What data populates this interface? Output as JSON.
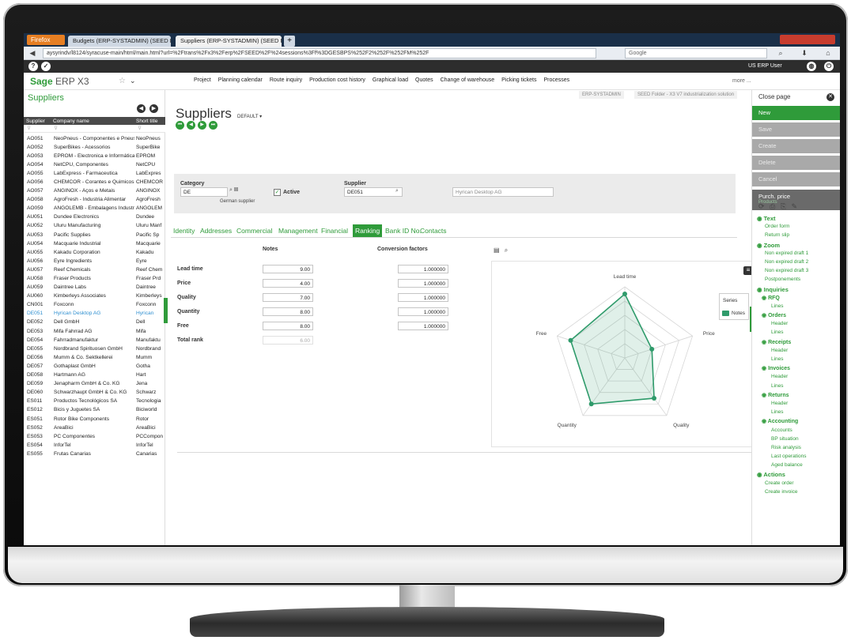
{
  "browser": {
    "firefox_label": "Firefox",
    "tabs": [
      {
        "label": "Budgets (ERP-SYSTADMIN) (SEED Fol..."
      },
      {
        "label": "Suppliers (ERP-SYSTADMIN) (SEED Fo..."
      }
    ],
    "new_tab": "+",
    "url": "aysyrindv/l8124/syracuse-main/html/main.html?url=%2Ftrans%2Fx3%2Ferp%2FSEED%2F%24sessions%3Ff%3DGESBPS%252F2%252F%252FM%252F",
    "search_placeholder": "Google"
  },
  "app": {
    "logo": "Sage",
    "logo_product": "ERP X3",
    "user_label": "US ERP User",
    "menu": [
      {
        "label": "Project",
        "dim": false
      },
      {
        "label": "Planning calendar",
        "dim": false
      },
      {
        "label": "Route inquiry",
        "dim": false
      },
      {
        "label": "Production cost history",
        "dim": false
      },
      {
        "label": "Graphical load",
        "dim": false
      },
      {
        "label": "Quotes",
        "dim": false
      },
      {
        "label": "Change of warehouse",
        "dim": false
      },
      {
        "label": "Picking tickets",
        "dim": false
      },
      {
        "label": "Processes",
        "dim": false
      }
    ],
    "more_label": "more ..."
  },
  "left": {
    "title": "Suppliers",
    "col_supplier": "Supplier",
    "col_company": "Company name",
    "col_short": "Short title",
    "filter_glyph": "⊽",
    "rows": [
      [
        "AO051",
        "NeoPneus - Componentes e Pneus",
        "NeoPneus"
      ],
      [
        "AO052",
        "SuperBikes - Acessorios",
        "SuperBike"
      ],
      [
        "AO053",
        "EPROM - Electronica e Informática",
        "EPROM"
      ],
      [
        "AO054",
        "NetCPU, Componentes",
        "NetCPU"
      ],
      [
        "AO055",
        "LabExpress - Farmaceutica",
        "LabExpres"
      ],
      [
        "AO056",
        "CHEMCOR - Corantes e Quimicos",
        "CHEMCOR"
      ],
      [
        "AO057",
        "ANGINOX - Aços e Metais",
        "ANGINOX"
      ],
      [
        "AO058",
        "AgroFresh - Industria Alimentar",
        "AgroFresh"
      ],
      [
        "AO059",
        "ANGOLEMB - Embalagens Industriais",
        "ANGOLEM"
      ],
      [
        "AU051",
        "Dundee Electronics",
        "Dundee"
      ],
      [
        "AU052",
        "Uluru Manufacturing",
        "Uluru Manf"
      ],
      [
        "AU053",
        "Pacific Supplies",
        "Pacific Sp"
      ],
      [
        "AU054",
        "Macquarie Industrial",
        "Macquarie"
      ],
      [
        "AU055",
        "Kakadu Corporation",
        "Kakadu"
      ],
      [
        "AU056",
        "Eyre Ingredients",
        "Eyre"
      ],
      [
        "AU057",
        "Reef Chemicals",
        "Reef Chem"
      ],
      [
        "AU058",
        "Fraser Products",
        "Fraser Prd"
      ],
      [
        "AU059",
        "Daintree Labs",
        "Daintree"
      ],
      [
        "AU060",
        "Kimberleys Associates",
        "Kimberleys"
      ],
      [
        "CN001",
        "Foxconn",
        "Foxconn"
      ],
      [
        "DE051",
        "Hyrican Desktop AG",
        "Hyrican"
      ],
      [
        "DE052",
        "Dell GmbH",
        "Dell"
      ],
      [
        "DE053",
        "Mifa Fahrrad AG",
        "Mifa"
      ],
      [
        "DE054",
        "Fahrradmanufaktur",
        "Manufaktu"
      ],
      [
        "DE055",
        "Nordbrand Spirituosen GmbH",
        "Nordbrand"
      ],
      [
        "DE056",
        "Mumm & Co. Sektkellerei",
        "Mumm"
      ],
      [
        "DE057",
        "Gothaplast GmbH",
        "Gotha"
      ],
      [
        "DE058",
        "Hartmann AG",
        "Hart"
      ],
      [
        "DE059",
        "Jenapharm GmbH & Co. KG",
        "Jena"
      ],
      [
        "DE060",
        "Schwarzhaupt GmbH & Co. KG",
        "Schwarz"
      ],
      [
        "ES011",
        "Productos Tecnológicos SA",
        "Tecnologia"
      ],
      [
        "ES012",
        "Bicis y Juguetes SA",
        "Biciworld"
      ],
      [
        "ES051",
        "Rotor Bike Components",
        "Rotor"
      ],
      [
        "ES052",
        "AreaBici",
        "AreaBici"
      ],
      [
        "ES053",
        "PC Componentes",
        "PCCompon"
      ],
      [
        "ES054",
        "InforTel",
        "InforTel"
      ],
      [
        "ES055",
        "Frutas Canarias",
        "Canarias"
      ]
    ],
    "selected_index": 20
  },
  "main": {
    "title": "Suppliers",
    "default_label": "DEFAULT ▾",
    "folder_1": "ERP-SYSTADMIN",
    "folder_2": "SEED Folder - X3 V7 industrialization solution",
    "category_label": "Category",
    "category_value": "DE",
    "category_desc": "German supplier",
    "active_label": "Active",
    "supplier_label": "Supplier",
    "supplier_value": "DE051",
    "supplier_name": "Hyrican Desktop AG",
    "tabs": [
      "Identity",
      "Addresses",
      "Commercial",
      "Management",
      "Financial",
      "Ranking",
      "Bank ID No.",
      "Contacts"
    ],
    "active_tab": "Ranking",
    "notes_header": "Notes",
    "factors_header": "Conversion factors",
    "ranking": [
      {
        "label": "Lead time",
        "note": "9.00",
        "factor": "1.000000"
      },
      {
        "label": "Price",
        "note": "4.00",
        "factor": "1.000000"
      },
      {
        "label": "Quality",
        "note": "7.00",
        "factor": "1.000000"
      },
      {
        "label": "Quantity",
        "note": "8.00",
        "factor": "1.000000"
      },
      {
        "label": "Free",
        "note": "8.00",
        "factor": "1.000000"
      }
    ],
    "total_label": "Total rank",
    "total_value": "6.00"
  },
  "chart_data": {
    "type": "radar",
    "axes": [
      "Lead time",
      "Price",
      "Quality",
      "Quantity",
      "Free"
    ],
    "series": [
      {
        "name": "Notes",
        "values": [
          9,
          4,
          7,
          8,
          8
        ]
      }
    ],
    "rmax": 10,
    "legend_title": "Series",
    "legend_position": "right",
    "color": "#2f9b6b"
  },
  "right": {
    "close_label": "Close page",
    "actions": [
      {
        "label": "New",
        "style": "green"
      },
      {
        "label": "Save",
        "style": "grey"
      },
      {
        "label": "Create",
        "style": "grey"
      },
      {
        "label": "Delete",
        "style": "grey"
      },
      {
        "label": "Cancel",
        "style": "grey"
      }
    ],
    "purch_label": "Purch. price",
    "purch_sub": "Products",
    "links": [
      {
        "label": "Text",
        "lvl": "h1"
      },
      {
        "label": "Order form",
        "lvl": "l1"
      },
      {
        "label": "Return slip",
        "lvl": "l1"
      },
      {
        "label": "Zoom",
        "lvl": "h1"
      },
      {
        "label": "Non expired draft 1",
        "lvl": "l1"
      },
      {
        "label": "Non expired draft 2",
        "lvl": "l1"
      },
      {
        "label": "Non expired draft 3",
        "lvl": "l1"
      },
      {
        "label": "Postponements",
        "lvl": "l1"
      },
      {
        "label": "Inquiries",
        "lvl": "h1"
      },
      {
        "label": "RFQ",
        "lvl": "h2"
      },
      {
        "label": "Lines",
        "lvl": "l2"
      },
      {
        "label": "Orders",
        "lvl": "h2"
      },
      {
        "label": "Header",
        "lvl": "l2"
      },
      {
        "label": "Lines",
        "lvl": "l2"
      },
      {
        "label": "Receipts",
        "lvl": "h2"
      },
      {
        "label": "Header",
        "lvl": "l2"
      },
      {
        "label": "Lines",
        "lvl": "l2"
      },
      {
        "label": "Invoices",
        "lvl": "h2"
      },
      {
        "label": "Header",
        "lvl": "l2"
      },
      {
        "label": "Lines",
        "lvl": "l2"
      },
      {
        "label": "Returns",
        "lvl": "h2"
      },
      {
        "label": "Header",
        "lvl": "l2"
      },
      {
        "label": "Lines",
        "lvl": "l2"
      },
      {
        "label": "Accounting",
        "lvl": "h2"
      },
      {
        "label": "Accounts",
        "lvl": "l2"
      },
      {
        "label": "BP situation",
        "lvl": "l2"
      },
      {
        "label": "Risk analysis",
        "lvl": "l2"
      },
      {
        "label": "Last operations",
        "lvl": "l2"
      },
      {
        "label": "Aged balance",
        "lvl": "l2"
      },
      {
        "label": "Actions",
        "lvl": "h1"
      },
      {
        "label": "Create order",
        "lvl": "l1"
      },
      {
        "label": "Create invoice",
        "lvl": "l1"
      }
    ]
  }
}
